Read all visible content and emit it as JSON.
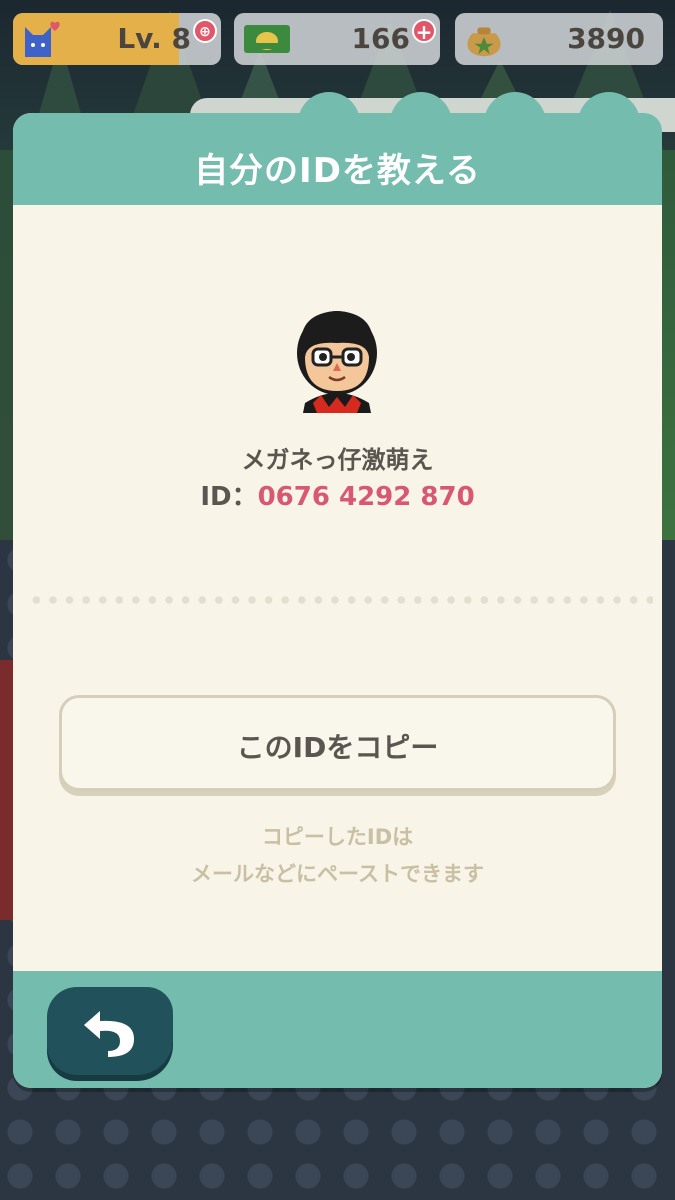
{
  "hud": {
    "level": {
      "label": "Lv. 8",
      "progress": 0.8,
      "icon": "cat-heart-icon",
      "badge": "add-icon"
    },
    "tickets": {
      "value": "166",
      "icon": "leaf-ticket-icon",
      "badge": "+"
    },
    "bells": {
      "value": "3890",
      "icon": "bell-bag-icon"
    }
  },
  "dialog": {
    "title": "自分のIDを教える",
    "player_name": "メガネっ仔激萌え",
    "id_label": "ID：",
    "id_value": "0676 4292 870",
    "copy_button_label": "このIDをコピー",
    "hint_line1": "コピーしたIDは",
    "hint_line2": "メールなどにペーストできます",
    "back_icon": "back-arrow-icon"
  },
  "colors": {
    "header": "#74bcae",
    "panel": "#f8f4e8",
    "id_value": "#d75870",
    "back_button": "#21525c"
  }
}
